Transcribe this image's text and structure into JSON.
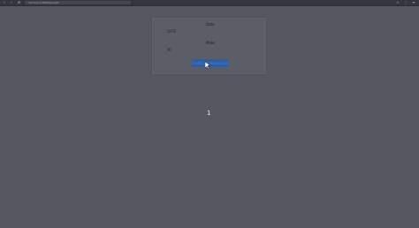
{
  "browser": {
    "nav": {
      "back_icon": "‹",
      "forward_icon": "›",
      "reload_icon": "⟳"
    },
    "url": "127.0.0.1:5000/predict",
    "right_icons": [
      "☆",
      "⋮",
      "≡"
    ]
  },
  "form": {
    "date_value": "Date",
    "date_label": "DATE",
    "mileage_value": "Miles",
    "mileage_label": "MI",
    "submit_label": "Predict Maintenance"
  },
  "result": {
    "value": "1"
  },
  "colors": {
    "background": "#555861",
    "button": "#2d5ea4",
    "text_light": "#f2f3f5"
  }
}
